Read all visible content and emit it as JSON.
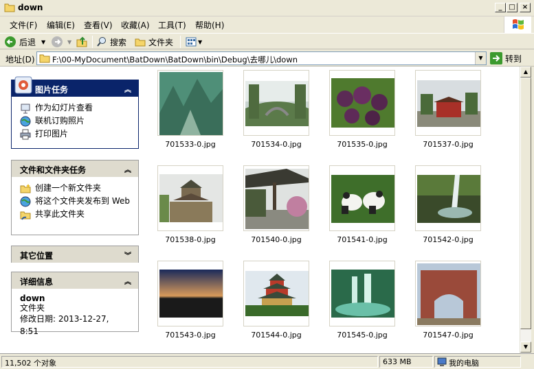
{
  "window": {
    "title": "down"
  },
  "menu": [
    "文件(F)",
    "编辑(E)",
    "查看(V)",
    "收藏(A)",
    "工具(T)",
    "帮助(H)"
  ],
  "toolbar": {
    "back_label": "后退",
    "search_label": "搜索",
    "folders_label": "文件夹"
  },
  "address": {
    "label": "地址(D)",
    "path": "F:\\00-MyDocument\\BatDown\\BatDown\\bin\\Debug\\去哪儿\\down",
    "go_label": "转到"
  },
  "tasks": {
    "picture_tasks": {
      "title": "图片任务",
      "items": [
        "作为幻灯片查看",
        "联机订购照片",
        "打印图片"
      ]
    },
    "file_tasks": {
      "title": "文件和文件夹任务",
      "items": [
        "创建一个新文件夹",
        "将这个文件夹发布到 Web",
        "共享此文件夹"
      ]
    },
    "other_places": {
      "title": "其它位置"
    },
    "details": {
      "title": "详细信息",
      "name": "down",
      "type": "文件夹",
      "modified": "修改日期: 2013-12-27, 8:51"
    }
  },
  "files": [
    {
      "name": "701533-0.jpg"
    },
    {
      "name": "701534-0.jpg"
    },
    {
      "name": "701535-0.jpg"
    },
    {
      "name": "701537-0.jpg"
    },
    {
      "name": "701538-0.jpg"
    },
    {
      "name": "701540-0.jpg"
    },
    {
      "name": "701541-0.jpg"
    },
    {
      "name": "701542-0.jpg"
    },
    {
      "name": "701543-0.jpg"
    },
    {
      "name": "701544-0.jpg"
    },
    {
      "name": "701545-0.jpg"
    },
    {
      "name": "701547-0.jpg"
    }
  ],
  "status": {
    "objects": "11,502 个对象",
    "size": "633 MB",
    "location": "我的电脑"
  }
}
